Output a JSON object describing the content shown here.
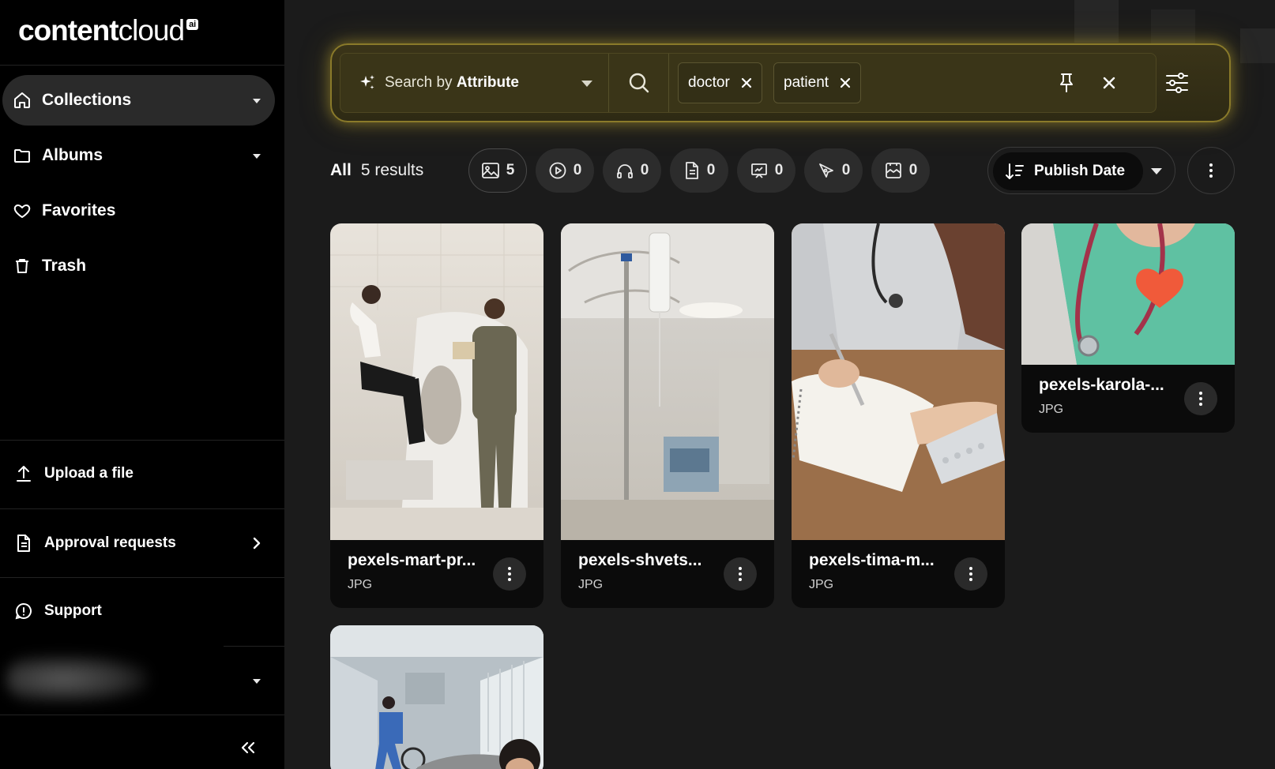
{
  "brand": {
    "word1": "content",
    "word2": "cloud",
    "badge": "ai"
  },
  "sidebar": {
    "items": [
      {
        "label": "Collections",
        "icon": "home-icon",
        "active": true
      },
      {
        "label": "Albums",
        "icon": "folder-icon"
      },
      {
        "label": "Favorites",
        "icon": "heart-icon"
      },
      {
        "label": "Trash",
        "icon": "trash-icon"
      }
    ],
    "actions": [
      {
        "label": "Upload a file",
        "icon": "upload-icon"
      },
      {
        "label": "Approval requests",
        "icon": "document-icon"
      },
      {
        "label": "Support",
        "icon": "support-icon"
      }
    ]
  },
  "search": {
    "mode_prefix": "Search by",
    "mode_bold": "Attribute",
    "chips": [
      "doctor",
      "patient"
    ]
  },
  "results": {
    "all_label": "All",
    "count_label": "5 results",
    "type_filters": [
      {
        "icon": "image-icon",
        "count": "5"
      },
      {
        "icon": "video-icon",
        "count": "0"
      },
      {
        "icon": "audio-icon",
        "count": "0"
      },
      {
        "icon": "document-icon",
        "count": "0"
      },
      {
        "icon": "presentation-icon",
        "count": "0"
      },
      {
        "icon": "vector-icon",
        "count": "0"
      },
      {
        "icon": "template-icon",
        "count": "0"
      }
    ],
    "sort_label": "Publish Date"
  },
  "assets": [
    {
      "name": "pexels-mart-pr...",
      "type": "JPG"
    },
    {
      "name": "pexels-shvets...",
      "type": "JPG"
    },
    {
      "name": "pexels-tima-m...",
      "type": "JPG"
    },
    {
      "name": "pexels-karola-...",
      "type": "JPG"
    },
    {
      "name": "",
      "type": ""
    }
  ],
  "colors": {
    "accent_glow": "#8a7a2a",
    "sidebar_bg": "#000000",
    "main_bg": "#1b1b1b",
    "card_bg": "#0b0b0b"
  }
}
